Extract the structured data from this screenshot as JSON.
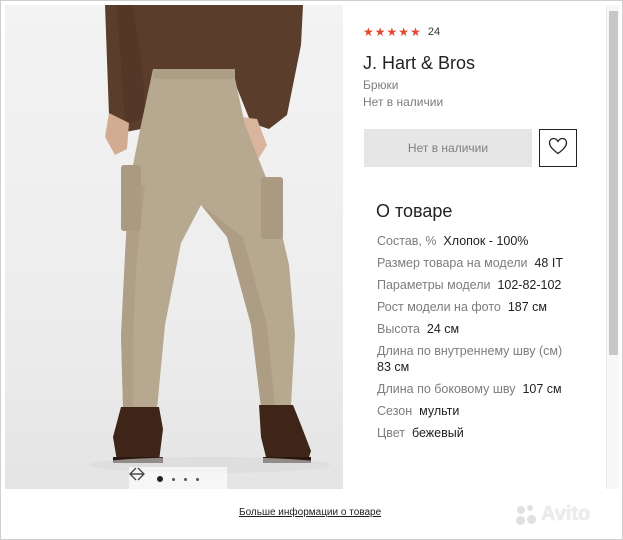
{
  "product": {
    "rating_stars": 5,
    "rating_count": "24",
    "brand": "J. Hart & Bros",
    "category": "Брюки",
    "availability": "Нет в наличии",
    "button_label": "Нет в наличии"
  },
  "carousel": {
    "slides": 4,
    "active": 1,
    "prev_icon": "arrow-left-icon",
    "next_icon": "arrow-right-icon"
  },
  "about": {
    "title": "О товаре",
    "specs": [
      {
        "label": "Состав, %",
        "value": "Хлопок - 100%"
      },
      {
        "label": "Размер товара на модели",
        "value": "48 IT"
      },
      {
        "label": "Параметры модели",
        "value": "102-82-102"
      },
      {
        "label": "Рост модели на фото",
        "value": "187 см"
      },
      {
        "label": "Высота",
        "value": "24 см"
      },
      {
        "label": "Длина по внутреннему шву (см)",
        "value": "83 см"
      },
      {
        "label": "Длина по боковому шву",
        "value": "107 см"
      },
      {
        "label": "Сезон",
        "value": "мульти"
      },
      {
        "label": "Цвет",
        "value": "бежевый"
      }
    ]
  },
  "footer": {
    "more_link": "Больше информации о товаре"
  },
  "watermark": {
    "text": "Avito"
  },
  "colors": {
    "star": "#e2492f",
    "sweater": "#5a3d2b",
    "pants": "#b7a98f",
    "boots": "#3f2418"
  },
  "icons": {
    "favorite": "heart-icon"
  }
}
